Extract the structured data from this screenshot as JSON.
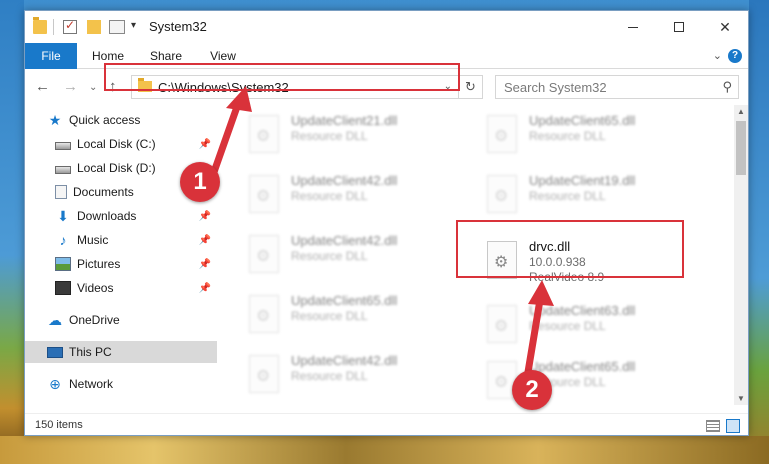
{
  "window": {
    "title": "System32",
    "minimize_label": "",
    "maximize_label": "",
    "close_label": "✕"
  },
  "ribbon": {
    "tabs": [
      "File",
      "Home",
      "Share",
      "View"
    ],
    "expand_glyph": "⌄",
    "help_glyph": "?"
  },
  "nav": {
    "back": "←",
    "forward": "→",
    "recent": "⌄",
    "up": "↑",
    "address": "C:\\Windows\\System32",
    "address_dd": "⌄",
    "refresh": "↻",
    "search_placeholder": "Search System32",
    "search_glyph": "⚲"
  },
  "sidebar": {
    "items": [
      {
        "label": "Quick access",
        "icon": "star-icon",
        "glyph": "★",
        "pinned": false
      },
      {
        "label": "Local Disk (C:)",
        "icon": "drive-icon",
        "glyph": "",
        "pinned": true
      },
      {
        "label": "Local Disk (D:)",
        "icon": "drive-icon",
        "glyph": "",
        "pinned": false
      },
      {
        "label": "Documents",
        "icon": "documents-icon",
        "glyph": "",
        "pinned": true
      },
      {
        "label": "Downloads",
        "icon": "download-icon",
        "glyph": "⬇",
        "pinned": true
      },
      {
        "label": "Music",
        "icon": "music-icon",
        "glyph": "♪",
        "pinned": true
      },
      {
        "label": "Pictures",
        "icon": "pictures-icon",
        "glyph": "",
        "pinned": true
      },
      {
        "label": "Videos",
        "icon": "videos-icon",
        "glyph": "",
        "pinned": true
      },
      {
        "label": "OneDrive",
        "icon": "cloud-icon",
        "glyph": "☁",
        "pinned": false
      },
      {
        "label": "This PC",
        "icon": "computer-icon",
        "glyph": "",
        "pinned": false
      },
      {
        "label": "Network",
        "icon": "network-icon",
        "glyph": "⊕",
        "pinned": false
      }
    ],
    "pin_glyph": "📌"
  },
  "files": {
    "left_column": [
      {
        "name": "UpdateClient21.dll",
        "sub1": "Resource DLL",
        "sub2": ""
      },
      {
        "name": "UpdateClient42.dll",
        "sub1": "Resource DLL",
        "sub2": ""
      },
      {
        "name": "UpdateClient42.dll",
        "sub1": "Resource DLL",
        "sub2": ""
      },
      {
        "name": "UpdateClient65.dll",
        "sub1": "Resource DLL",
        "sub2": ""
      },
      {
        "name": "UpdateClient42.dll",
        "sub1": "Resource DLL",
        "sub2": ""
      }
    ],
    "right_column": [
      {
        "name": "UpdateClient65.dll",
        "sub1": "Resource DLL",
        "sub2": ""
      },
      {
        "name": "UpdateClient19.dll",
        "sub1": "Resource DLL",
        "sub2": ""
      },
      {
        "name": "drvc.dll",
        "sub1": "10.0.0.938",
        "sub2": "RealVideo 8.9"
      },
      {
        "name": "UpdateClient63.dll",
        "sub1": "Resource DLL",
        "sub2": ""
      },
      {
        "name": "UpdateClient65.dll",
        "sub1": "Resource DLL",
        "sub2": ""
      }
    ]
  },
  "status": {
    "items_count": "150 items"
  },
  "callouts": [
    "1",
    "2"
  ],
  "colors": {
    "accent": "#1979ca",
    "annotation": "#d9323a"
  }
}
